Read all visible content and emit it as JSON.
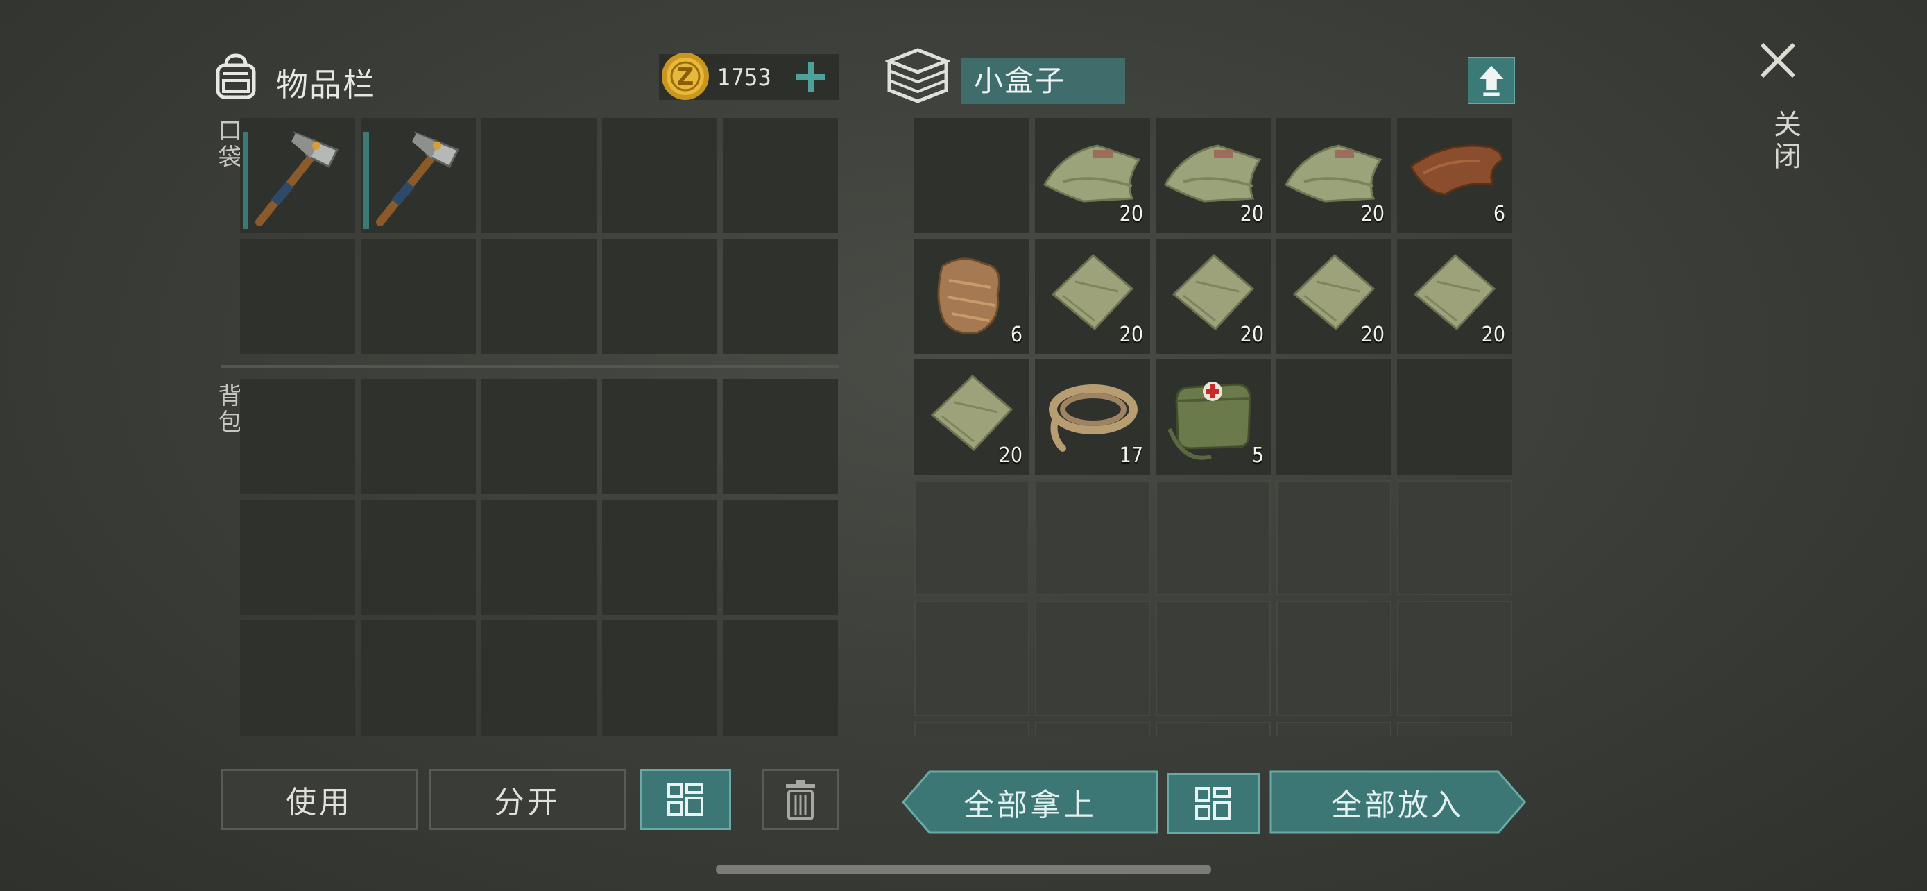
{
  "inventory": {
    "title": "物品栏",
    "coins": "1753",
    "pocket_label": "口袋",
    "backpack_label": "背包",
    "pocket_items": [
      {
        "icon": "pickaxe-icon",
        "qty": "",
        "selected": true
      },
      {
        "icon": "pickaxe-icon",
        "qty": "",
        "selected": true
      },
      {
        "icon": "",
        "qty": ""
      },
      {
        "icon": "",
        "qty": ""
      },
      {
        "icon": "",
        "qty": ""
      },
      {
        "icon": "",
        "qty": ""
      },
      {
        "icon": "",
        "qty": ""
      },
      {
        "icon": "",
        "qty": ""
      },
      {
        "icon": "",
        "qty": ""
      },
      {
        "icon": "",
        "qty": ""
      }
    ]
  },
  "container": {
    "name": "小盒子",
    "items": [
      {
        "icon": "",
        "qty": ""
      },
      {
        "icon": "cloth-icon",
        "qty": "20"
      },
      {
        "icon": "cloth-icon",
        "qty": "20"
      },
      {
        "icon": "cloth-icon",
        "qty": "20"
      },
      {
        "icon": "leather-icon",
        "qty": "6"
      },
      {
        "icon": "fur-icon",
        "qty": "6"
      },
      {
        "icon": "fabric-scrap-icon",
        "qty": "20"
      },
      {
        "icon": "fabric-scrap-icon",
        "qty": "20"
      },
      {
        "icon": "fabric-scrap-icon",
        "qty": "20"
      },
      {
        "icon": "fabric-scrap-icon",
        "qty": "20"
      },
      {
        "icon": "fabric-scrap-icon",
        "qty": "20"
      },
      {
        "icon": "rope-icon",
        "qty": "17"
      },
      {
        "icon": "medkit-bag-icon",
        "qty": "5"
      }
    ]
  },
  "buttons": {
    "use": "使用",
    "split": "分开",
    "take_all": "全部拿上",
    "put_all": "全部放入"
  },
  "close_label": "关闭",
  "colors": {
    "accent": "#3d7775",
    "slot": "#2f312d"
  }
}
